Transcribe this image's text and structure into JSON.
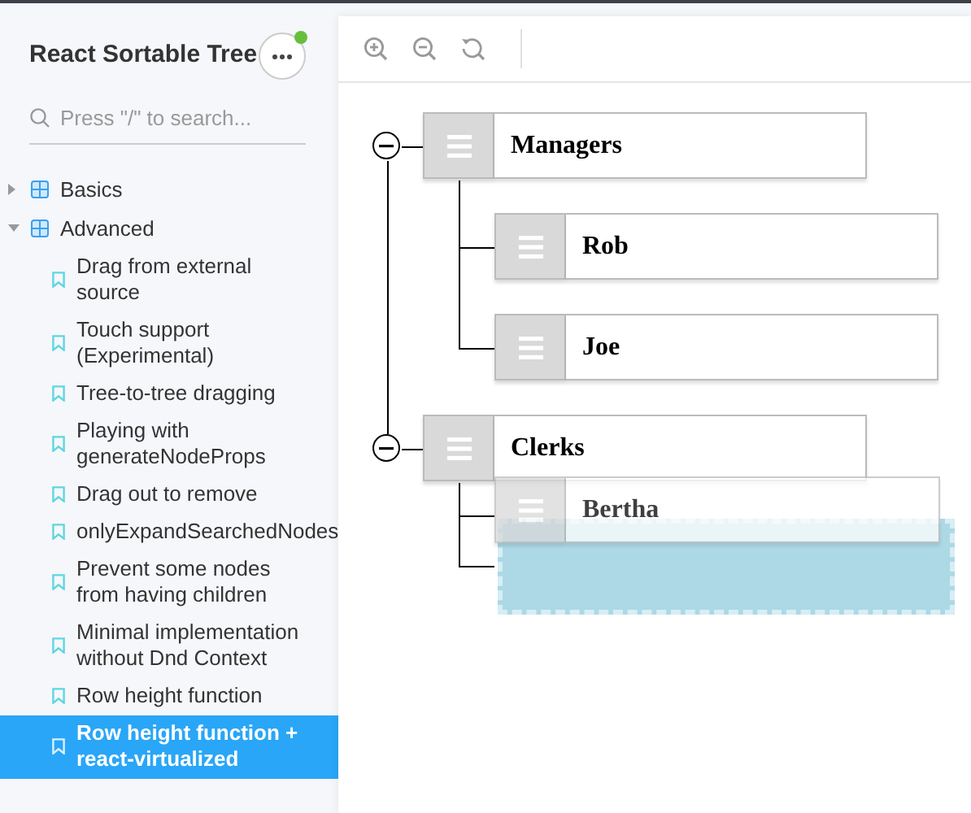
{
  "sidebar": {
    "title": "React Sortable Tree",
    "has_notification": true,
    "search": {
      "placeholder": "Press \"/\" to search..."
    },
    "groups": [
      {
        "label": "Basics",
        "expanded": false
      },
      {
        "label": "Advanced",
        "expanded": true,
        "items": [
          {
            "label": "Drag from external source",
            "selected": false
          },
          {
            "label": "Touch support (Experimental)",
            "selected": false
          },
          {
            "label": "Tree-to-tree dragging",
            "selected": false
          },
          {
            "label": "Playing with generateNodeProps",
            "selected": false
          },
          {
            "label": "Drag out to remove",
            "selected": false
          },
          {
            "label": "onlyExpandSearchedNodes",
            "selected": false
          },
          {
            "label": "Prevent some nodes from having children",
            "selected": false
          },
          {
            "label": "Minimal implementation without Dnd Context",
            "selected": false
          },
          {
            "label": "Row height function",
            "selected": false
          },
          {
            "label": "Row height function + react-virtualized",
            "selected": true
          }
        ]
      }
    ]
  },
  "tree": {
    "nodes": [
      {
        "title": "Managers",
        "expanded": true,
        "children": [
          {
            "title": "Rob"
          },
          {
            "title": "Joe"
          }
        ]
      },
      {
        "title": "Clerks",
        "expanded": true,
        "children": [
          {
            "kind": "drop-placeholder"
          }
        ]
      }
    ],
    "dragging": {
      "title": "Bertha"
    }
  }
}
